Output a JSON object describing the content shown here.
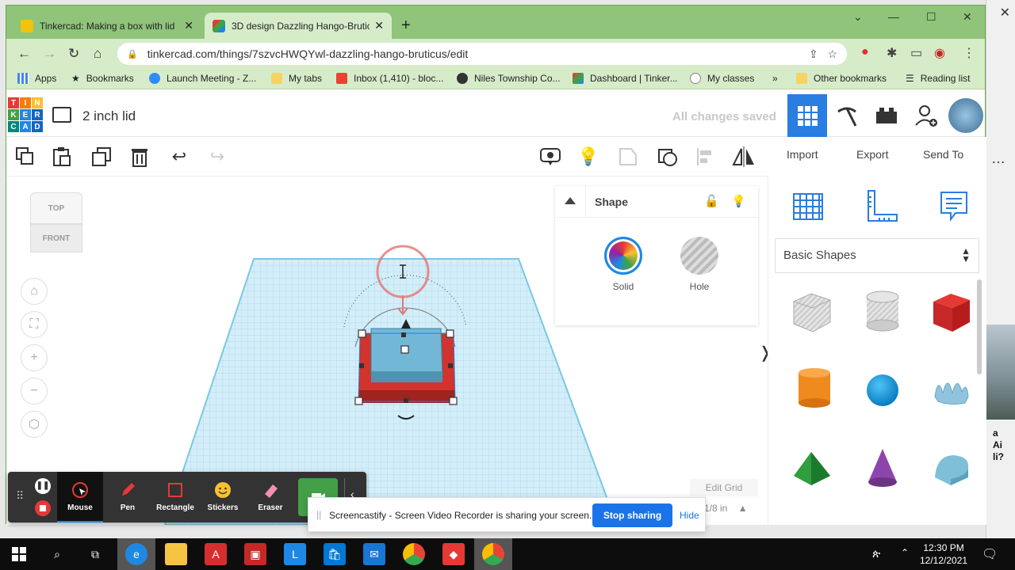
{
  "browser": {
    "tabs": [
      {
        "title": "Tinkercad: Making a box with lid",
        "active": false
      },
      {
        "title": "3D design Dazzling Hango-Bruticus",
        "active": true
      }
    ],
    "url": "tinkercad.com/things/7szvcHWQYwl-dazzling-hango-bruticus/edit",
    "bookmarks": [
      {
        "label": "Apps",
        "icon": "apps-grid-icon"
      },
      {
        "label": "Bookmarks",
        "icon": "star-icon"
      },
      {
        "label": "Launch Meeting - Z...",
        "icon": "zoom-icon"
      },
      {
        "label": "My tabs",
        "icon": "folder-icon"
      },
      {
        "label": "Inbox (1,410) - bloc...",
        "icon": "gmail-icon"
      },
      {
        "label": "Niles Township Co...",
        "icon": "globe-icon"
      },
      {
        "label": "Dashboard | Tinker...",
        "icon": "tinkercad-icon"
      },
      {
        "label": "My classes",
        "icon": "classes-icon"
      }
    ],
    "bookmarks_overflow": "»",
    "other_bookmarks": "Other bookmarks",
    "reading_list": "Reading list"
  },
  "tinkercad": {
    "logo_letters": [
      "T",
      "I",
      "N",
      "K",
      "E",
      "R",
      "C",
      "A",
      "D"
    ],
    "design_title": "2 inch lid",
    "save_status": "All changes saved",
    "toolbar_right": {
      "import": "Import",
      "export": "Export",
      "send_to": "Send To"
    },
    "viewcube": {
      "top": "TOP",
      "front": "FRONT"
    },
    "shape_panel": {
      "title": "Shape",
      "solid": "Solid",
      "hole": "Hole"
    },
    "library": {
      "category": "Basic Shapes",
      "shapes": [
        "box-hole",
        "cylinder-hole",
        "box",
        "cylinder",
        "sphere",
        "scribble",
        "roof",
        "cone",
        "round-roof"
      ]
    },
    "edit_grid": "Edit Grid",
    "snap_grid": "1/8 in",
    "colors": {
      "accent": "#2a7de1",
      "box_red": "#d0342c",
      "selected_blue": "#72b8d6"
    }
  },
  "screencastify": {
    "tools": [
      {
        "label": "Mouse",
        "active": true
      },
      {
        "label": "Pen",
        "active": false
      },
      {
        "label": "Rectangle",
        "active": false
      },
      {
        "label": "Stickers",
        "active": false
      },
      {
        "label": "Eraser",
        "active": false
      }
    ],
    "share_message": "Screencastify - Screen Video Recorder is sharing your screen.",
    "stop_label": "Stop sharing",
    "hide_label": "Hide"
  },
  "taskbar": {
    "time": "12:30 PM",
    "date": "12/12/2021"
  },
  "desktop": {
    "side_text": "a\nAi\nli?"
  }
}
